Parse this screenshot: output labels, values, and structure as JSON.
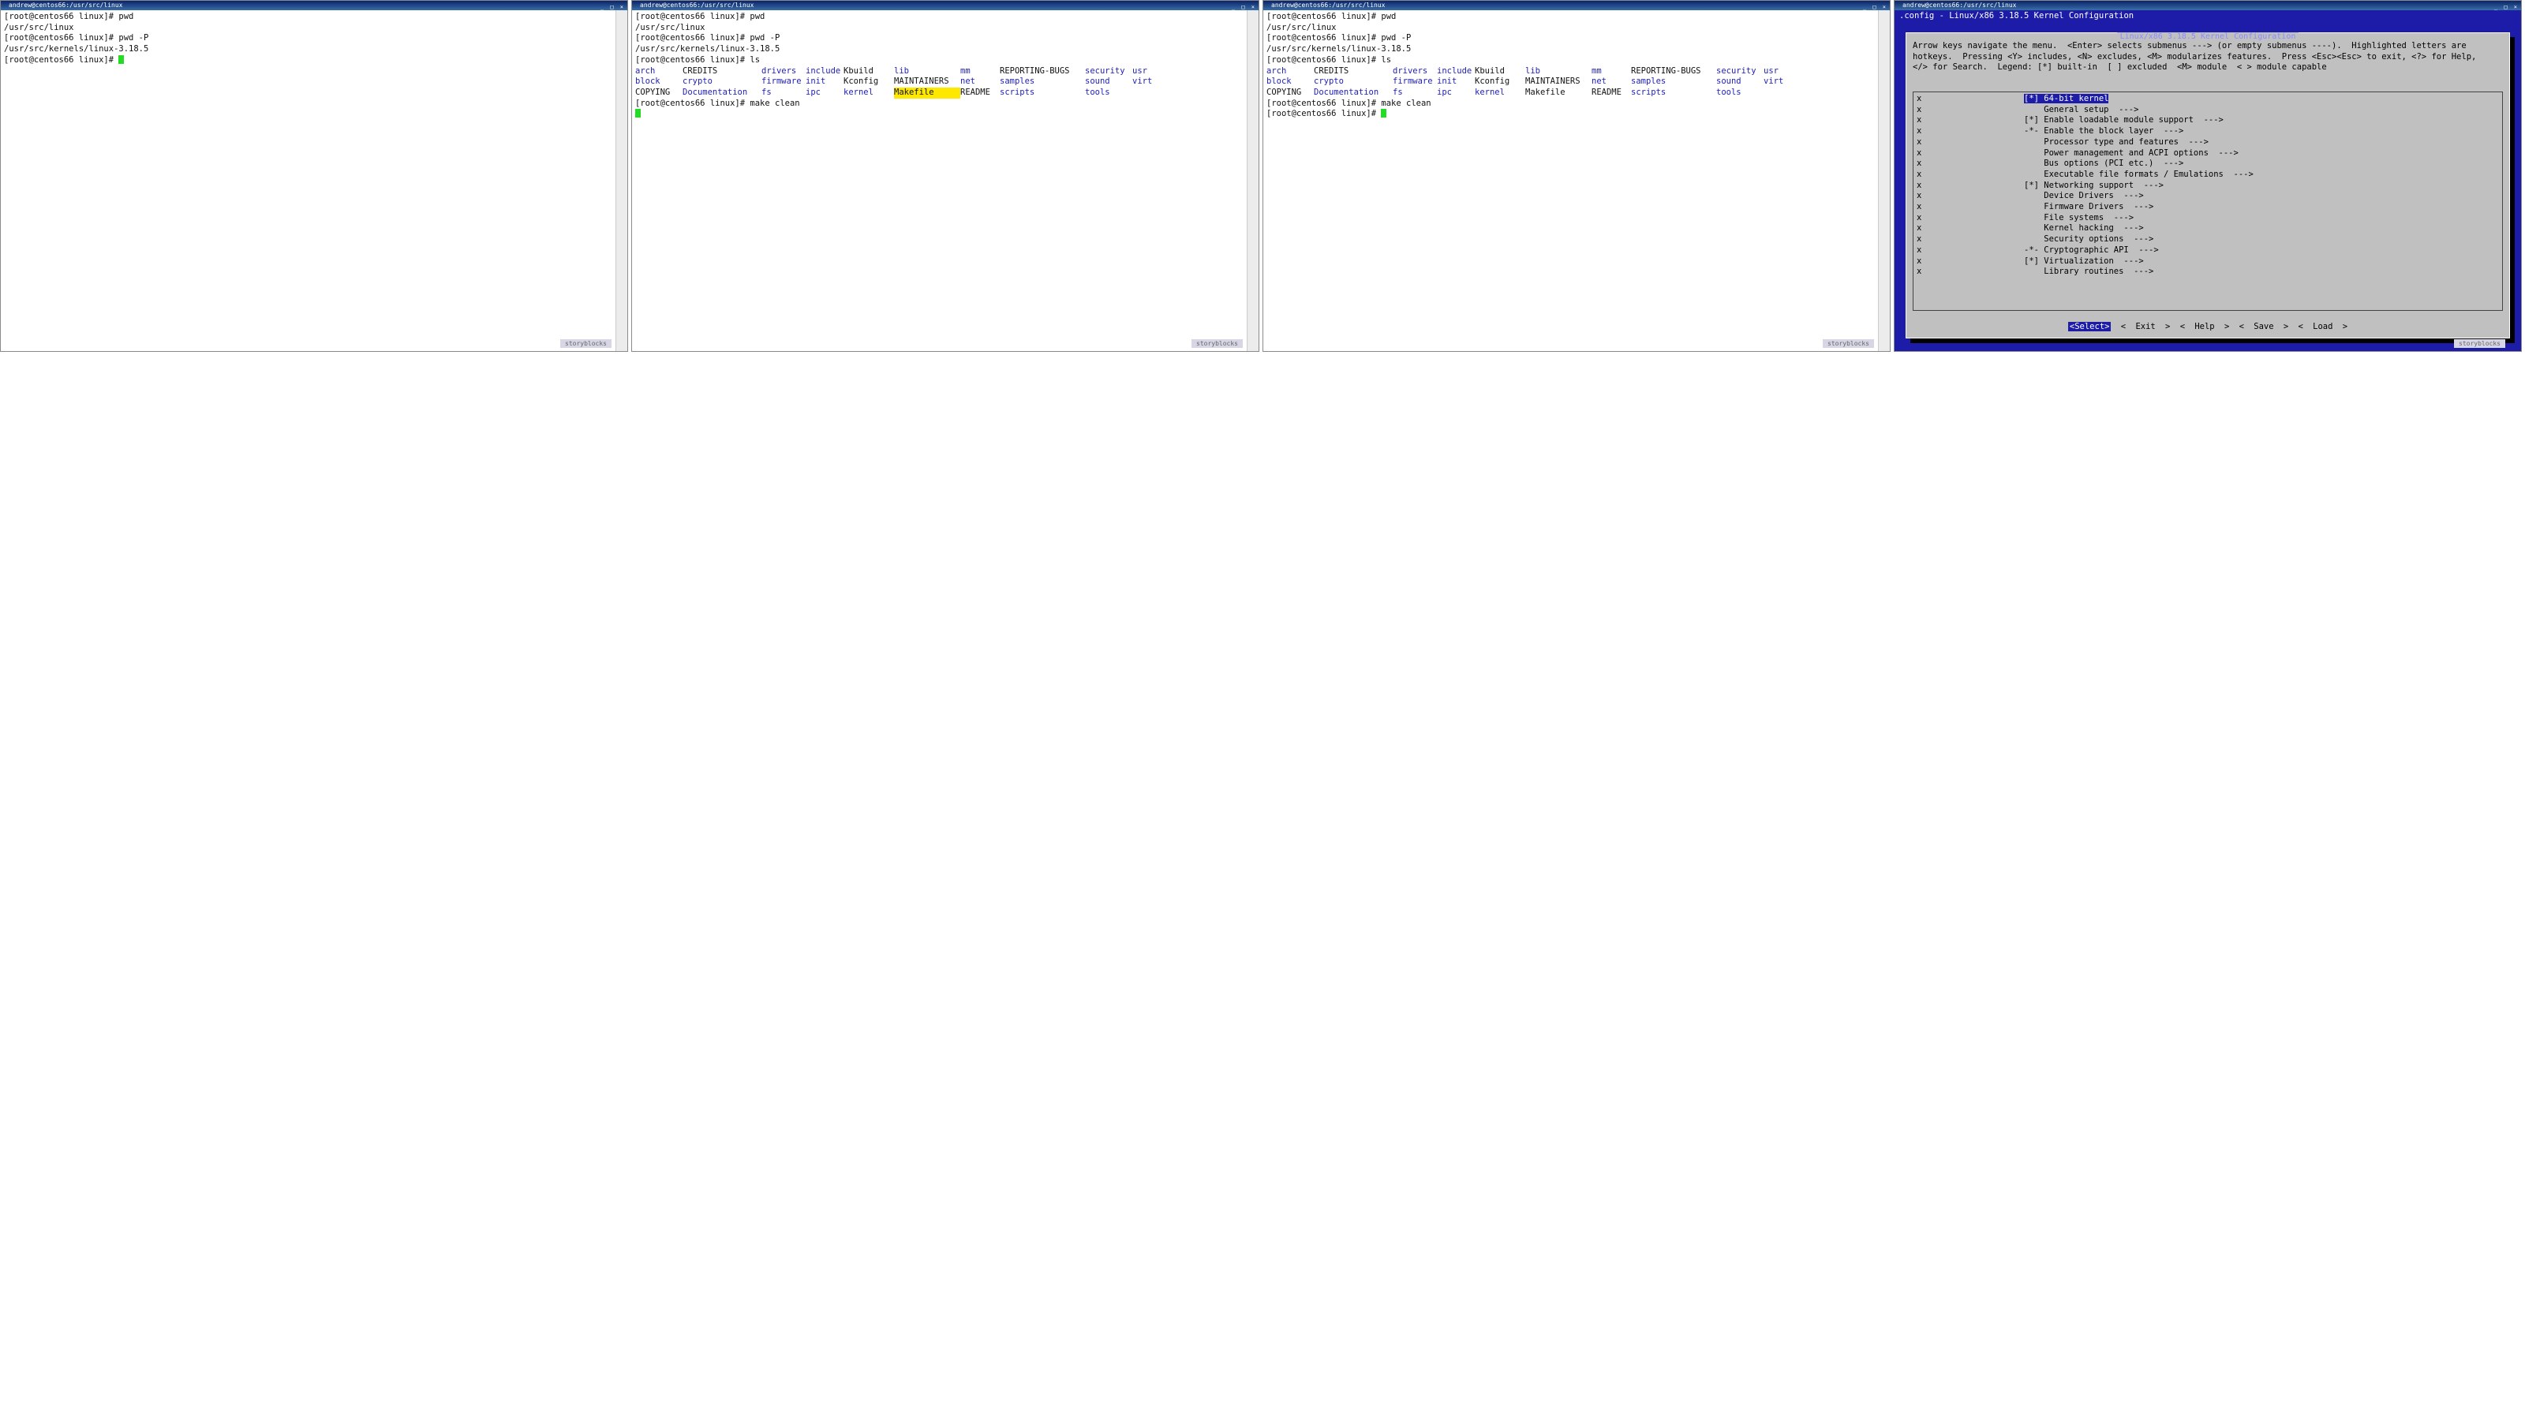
{
  "titlebar": "andrew@centos66:/usr/src/linux",
  "window_controls": "_ □ ×",
  "watermark": "storyblocks",
  "p1": {
    "lines": [
      "[root@centos66 linux]# pwd",
      "/usr/src/linux",
      "[root@centos66 linux]# pwd -P",
      "/usr/src/kernels/linux-3.18.5",
      "[root@centos66 linux]# "
    ]
  },
  "p2": {
    "pre": [
      "[root@centos66 linux]# pwd",
      "/usr/src/linux",
      "[root@centos66 linux]# pwd -P",
      "/usr/src/kernels/linux-3.18.5",
      "[root@centos66 linux]# ls"
    ],
    "ls": [
      [
        "arch",
        "CREDITS",
        "drivers",
        "include",
        "Kbuild",
        "lib",
        "mm",
        "REPORTING-BUGS",
        "security",
        "usr"
      ],
      [
        "block",
        "crypto",
        "firmware",
        "init",
        "Kconfig",
        "MAINTAINERS",
        "net",
        "samples",
        "sound",
        "virt"
      ],
      [
        "COPYING",
        "Documentation",
        "fs",
        "ipc",
        "kernel",
        "Makefile",
        "README",
        "scripts",
        "tools",
        ""
      ]
    ],
    "post": "[root@centos66 linux]# make clean"
  },
  "p3": {
    "post": "[root@centos66 linux]# "
  },
  "menuconfig": {
    "header": ".config - Linux/x86 3.18.5 Kernel Configuration",
    "box_title": "Linux/x86 3.18.5 Kernel Configuration",
    "help": [
      "Arrow keys navigate the menu.  <Enter> selects submenus ---> (or empty submenus ----).  Highlighted letters are",
      "hotkeys.  Pressing <Y> includes, <N> excludes, <M> modularizes features.  Press <Esc><Esc> to exit, <?> for Help,",
      "</> for Search.  Legend: [*] built-in  [ ] excluded  <M> module  < > module capable"
    ],
    "items": [
      "[*] 64-bit kernel",
      "    General setup  --->",
      "[*] Enable loadable module support  --->",
      "-*- Enable the block layer  --->",
      "    Processor type and features  --->",
      "    Power management and ACPI options  --->",
      "    Bus options (PCI etc.)  --->",
      "    Executable file formats / Emulations  --->",
      "[*] Networking support  --->",
      "    Device Drivers  --->",
      "    Firmware Drivers  --->",
      "    File systems  --->",
      "    Kernel hacking  --->",
      "    Security options  --->",
      "-*- Cryptographic API  --->",
      "[*] Virtualization  --->",
      "    Library routines  --->"
    ],
    "buttons": {
      "select": "<Select>",
      "exit": "< Exit >",
      "help": "< Help >",
      "save": "< Save >",
      "load": "< Load >"
    }
  }
}
